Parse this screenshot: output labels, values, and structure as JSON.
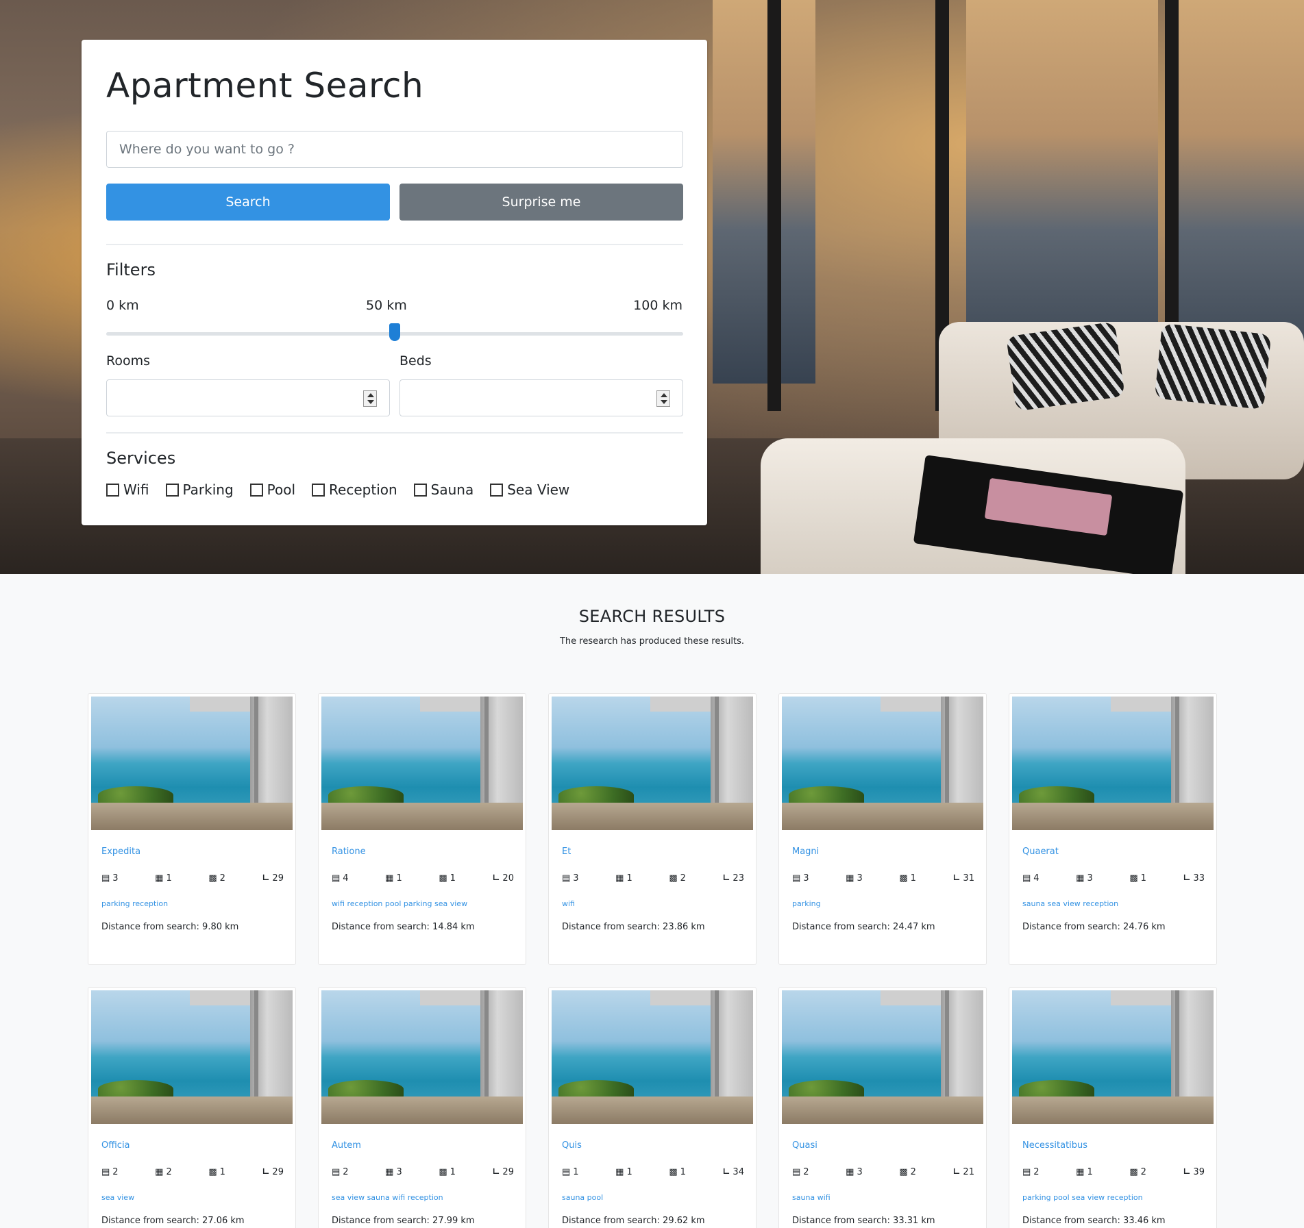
{
  "search": {
    "title": "Apartment Search",
    "placeholder": "Where do you want to go ?",
    "search_label": "Search",
    "surprise_label": "Surprise me"
  },
  "filters": {
    "heading": "Filters",
    "min_label": "0 km",
    "current_label": "50 km",
    "max_label": "100 km",
    "slider_value_fraction": 0.5,
    "rooms_label": "Rooms",
    "beds_label": "Beds",
    "rooms_value": "",
    "beds_value": ""
  },
  "services": {
    "heading": "Services",
    "items": [
      "Wifi",
      "Parking",
      "Pool",
      "Reception",
      "Sauna",
      "Sea View"
    ]
  },
  "results": {
    "title": "SEARCH RESULTS",
    "subtitle": "The research has produced these results.",
    "cards": [
      {
        "name": "Expedita",
        "beds": "3",
        "rooms": "1",
        "bathrooms": "2",
        "size": "29",
        "tags": "parking reception",
        "distance": "Distance from search: 9.80 km"
      },
      {
        "name": "Ratione",
        "beds": "4",
        "rooms": "1",
        "bathrooms": "1",
        "size": "20",
        "tags": "wifi reception pool parking sea view",
        "distance": "Distance from search: 14.84 km"
      },
      {
        "name": "Et",
        "beds": "3",
        "rooms": "1",
        "bathrooms": "2",
        "size": "23",
        "tags": "wifi",
        "distance": "Distance from search: 23.86 km"
      },
      {
        "name": "Magni",
        "beds": "3",
        "rooms": "3",
        "bathrooms": "1",
        "size": "31",
        "tags": "parking",
        "distance": "Distance from search: 24.47 km"
      },
      {
        "name": "Quaerat",
        "beds": "4",
        "rooms": "3",
        "bathrooms": "1",
        "size": "33",
        "tags": "sauna sea view reception",
        "distance": "Distance from search: 24.76 km"
      },
      {
        "name": "Officia",
        "beds": "2",
        "rooms": "2",
        "bathrooms": "1",
        "size": "29",
        "tags": "sea view",
        "distance": "Distance from search: 27.06 km"
      },
      {
        "name": "Autem",
        "beds": "2",
        "rooms": "3",
        "bathrooms": "1",
        "size": "29",
        "tags": "sea view sauna wifi reception",
        "distance": "Distance from search: 27.99 km"
      },
      {
        "name": "Quis",
        "beds": "1",
        "rooms": "1",
        "bathrooms": "1",
        "size": "34",
        "tags": "sauna pool",
        "distance": "Distance from search: 29.62 km"
      },
      {
        "name": "Quasi",
        "beds": "2",
        "rooms": "3",
        "bathrooms": "2",
        "size": "21",
        "tags": "sauna wifi",
        "distance": "Distance from search: 33.31 km"
      },
      {
        "name": "Necessitatibus",
        "beds": "2",
        "rooms": "1",
        "bathrooms": "2",
        "size": "39",
        "tags": "parking pool sea view reception",
        "distance": "Distance from search: 33.46 km"
      }
    ]
  },
  "icons": {
    "bed": "bed-icon",
    "rooms": "door-icon",
    "bathroom": "toilet-icon",
    "size": "area-icon"
  },
  "colors": {
    "primary": "#3392e3",
    "secondary": "#6c757d",
    "background": "#f8f9fa"
  }
}
